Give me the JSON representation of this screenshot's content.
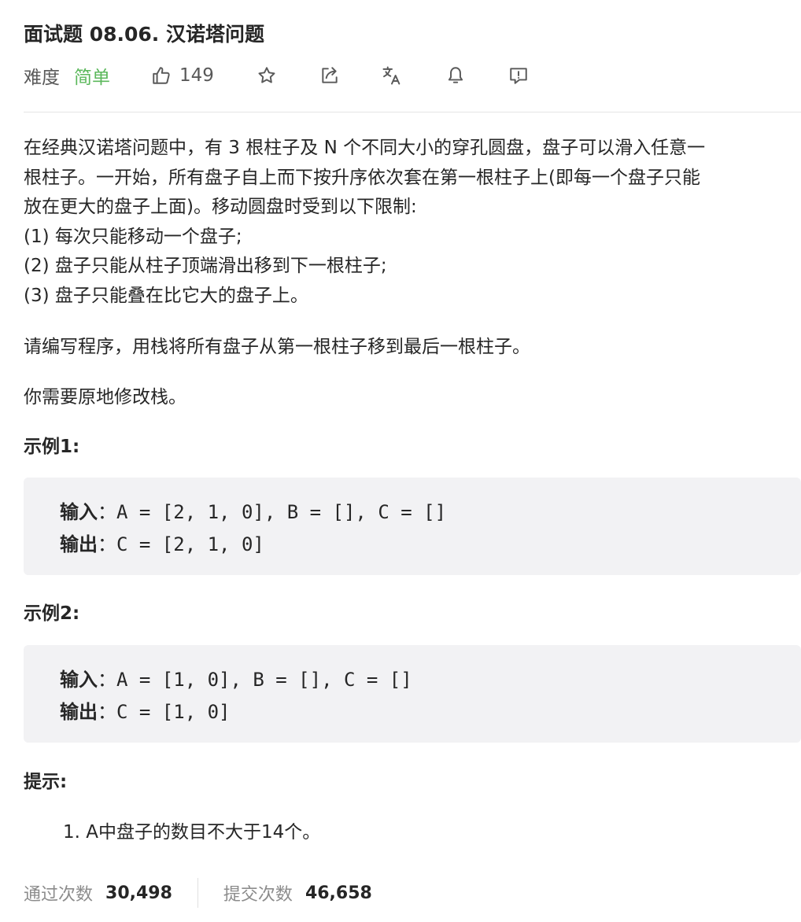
{
  "problem": {
    "title": "面试题 08.06. 汉诺塔问题",
    "difficulty_label": "难度",
    "difficulty": "简单",
    "likes": "149"
  },
  "icons": {
    "like": "thumbs-up-icon",
    "star": "star-icon",
    "share": "share-icon",
    "translate": "translate-icon",
    "bell": "bell-icon",
    "feedback": "feedback-icon"
  },
  "colors": {
    "difficulty_easy": "#5cb85c",
    "code_bg": "#f2f2f4"
  },
  "description": {
    "lines": [
      "在经典汉诺塔问题中，有 3 根柱子及 N 个不同大小的穿孔圆盘，盘子可以滑入任意一",
      "根柱子。一开始，所有盘子自上而下按升序依次套在第一根柱子上(即每一个盘子只能",
      "放在更大的盘子上面)。移动圆盘时受到以下限制:",
      "(1) 每次只能移动一个盘子;",
      "(2) 盘子只能从柱子顶端滑出移到下一根柱子;",
      "(3) 盘子只能叠在比它大的盘子上。"
    ],
    "task": "请编写程序，用栈将所有盘子从第一根柱子移到最后一根柱子。",
    "note": "你需要原地修改栈。"
  },
  "examples": [
    {
      "heading": "示例1:",
      "input_label": "输入",
      "input_text": "：A = [2, 1, 0], B = [], C = []",
      "output_label": "输出",
      "output_text": "：C = [2, 1, 0]"
    },
    {
      "heading": "示例2:",
      "input_label": "输入",
      "input_text": "：A = [1, 0], B = [], C = []",
      "output_label": "输出",
      "output_text": "：C = [1, 0]"
    }
  ],
  "hints": {
    "heading": "提示:",
    "items": [
      "1. A中盘子的数目不大于14个。"
    ]
  },
  "stats": {
    "accepted_label": "通过次数",
    "accepted": "30,498",
    "submitted_label": "提交次数",
    "submitted": "46,658"
  }
}
